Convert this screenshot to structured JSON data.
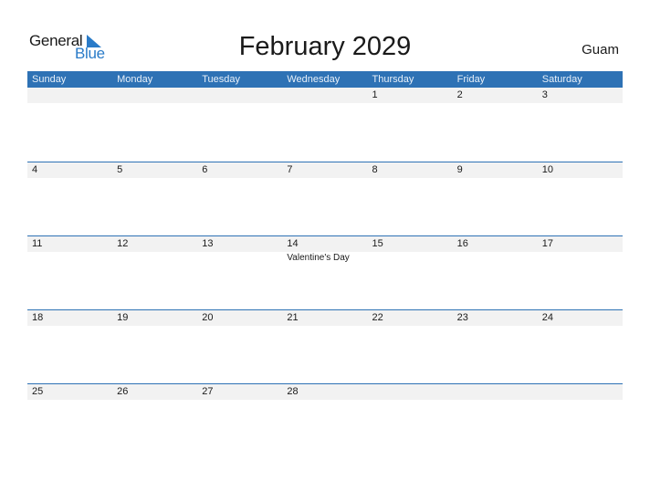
{
  "logo": {
    "word1": "General",
    "word2": "Blue"
  },
  "title": "February 2029",
  "region": "Guam",
  "colors": {
    "header_bg": "#2e72b5",
    "header_text": "#e8f0f9",
    "date_strip_bg": "#f2f2f2",
    "logo_blue": "#2a7bc8"
  },
  "weekdays": [
    "Sunday",
    "Monday",
    "Tuesday",
    "Wednesday",
    "Thursday",
    "Friday",
    "Saturday"
  ],
  "weeks": [
    {
      "days": [
        "",
        "",
        "",
        "",
        "1",
        "2",
        "3"
      ],
      "events": [
        "",
        "",
        "",
        "",
        "",
        "",
        ""
      ]
    },
    {
      "days": [
        "4",
        "5",
        "6",
        "7",
        "8",
        "9",
        "10"
      ],
      "events": [
        "",
        "",
        "",
        "",
        "",
        "",
        ""
      ]
    },
    {
      "days": [
        "11",
        "12",
        "13",
        "14",
        "15",
        "16",
        "17"
      ],
      "events": [
        "",
        "",
        "",
        "Valentine's Day",
        "",
        "",
        ""
      ]
    },
    {
      "days": [
        "18",
        "19",
        "20",
        "21",
        "22",
        "23",
        "24"
      ],
      "events": [
        "",
        "",
        "",
        "",
        "",
        "",
        ""
      ]
    },
    {
      "days": [
        "25",
        "26",
        "27",
        "28",
        "",
        "",
        ""
      ],
      "events": [
        "",
        "",
        "",
        "",
        "",
        "",
        ""
      ]
    }
  ]
}
